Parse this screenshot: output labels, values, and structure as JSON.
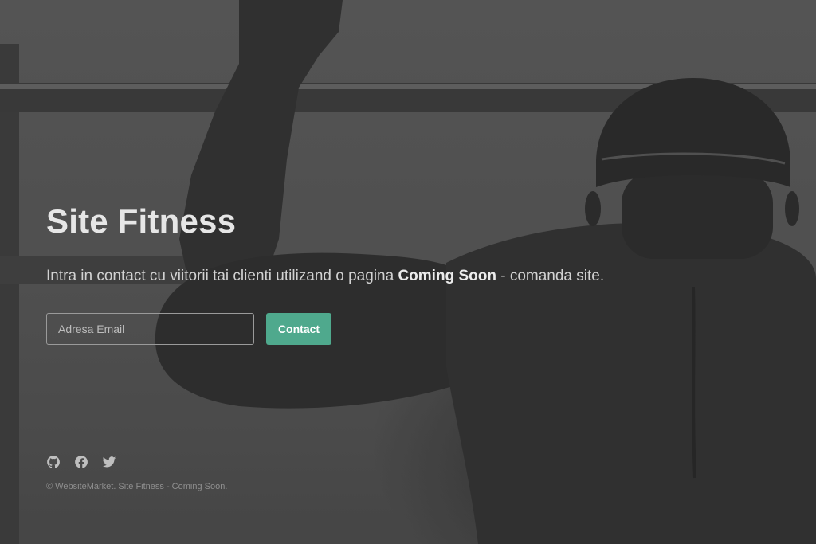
{
  "page": {
    "title": "Site Fitness",
    "lead_prefix": "Intra in contact cu viitorii tai clienti utilizand o pagina ",
    "lead_bold": "Coming Soon",
    "lead_suffix": " - comanda site."
  },
  "form": {
    "email_placeholder": "Adresa Email",
    "email_value": "",
    "submit_label": "Contact"
  },
  "footer": {
    "socials": [
      {
        "name": "github-icon"
      },
      {
        "name": "facebook-icon"
      },
      {
        "name": "twitter-icon"
      }
    ],
    "copyright": "© WebsiteMarket. Site Fitness - Coming Soon."
  },
  "colors": {
    "accent": "#4fa98d",
    "text": "#e6e6e6",
    "muted": "#8f8f8f",
    "icon": "#bfbfbf"
  }
}
